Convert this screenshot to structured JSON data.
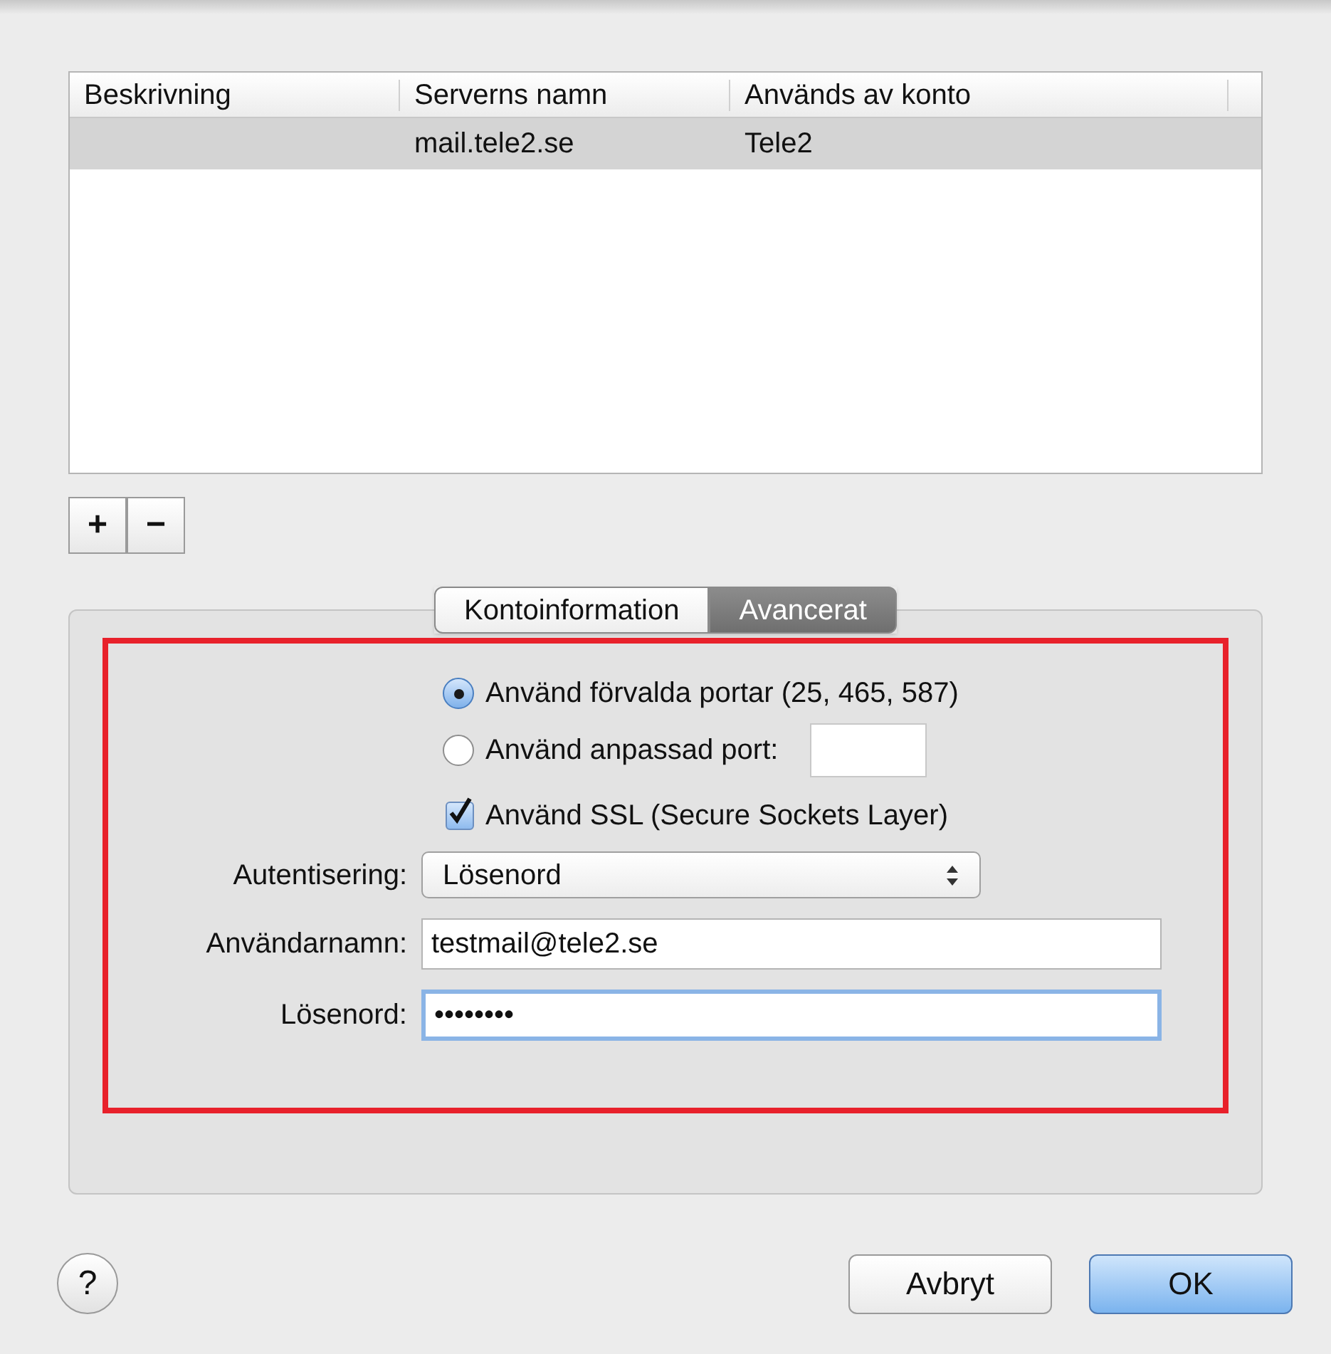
{
  "table": {
    "columns": [
      "Beskrivning",
      "Serverns namn",
      "Används av konto"
    ],
    "rows": [
      {
        "cells": [
          "",
          "mail.tele2.se",
          "Tele2"
        ],
        "selected": true
      }
    ]
  },
  "list_buttons": [
    "+",
    "−"
  ],
  "tabs": [
    {
      "label": "Kontoinformation",
      "selected": false
    },
    {
      "label": "Avancerat",
      "selected": true
    }
  ],
  "port_options": [
    {
      "label": "Använd förvalda portar (25, 465, 587)",
      "selected": true
    },
    {
      "label": "Använd anpassad port:",
      "selected": false,
      "has_field": true
    }
  ],
  "ssl": {
    "label": "Använd SSL (Secure Sockets Layer)",
    "checked": true
  },
  "fields": [
    {
      "kind": "select",
      "label": "Autentisering:",
      "value": "Lösenord"
    },
    {
      "kind": "text",
      "label": "Användarnamn:",
      "value": "testmail@tele2.se",
      "focused": false
    },
    {
      "kind": "text",
      "label": "Lösenord:",
      "value": "••••••••",
      "focused": true
    }
  ],
  "help": "?",
  "buttons": [
    {
      "label": "Avbryt",
      "default": false
    },
    {
      "label": "OK",
      "default": true
    }
  ]
}
